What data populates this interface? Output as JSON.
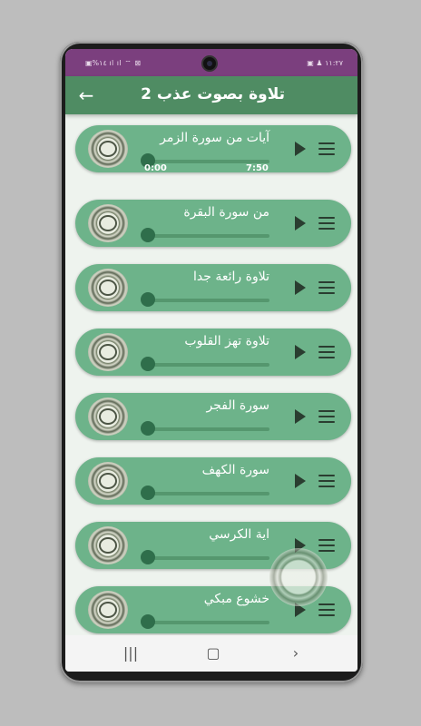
{
  "status": {
    "left": "▣%١٤ ıl ıl ⌔ ⊠",
    "right": "▣ ♟ ١١:٢٧"
  },
  "header": {
    "title": "تلاوة بصوت عذب 2",
    "back_icon": "arrow-left-icon"
  },
  "tracks": [
    {
      "title": "آيات من سورة الزمر",
      "start": "0:00",
      "end": "7:50"
    },
    {
      "title": "من سورة البقرة"
    },
    {
      "title": "تلاوة رائعة جدا"
    },
    {
      "title": "تلاوة تهز القلوب"
    },
    {
      "title": "سورة الفجر"
    },
    {
      "title": "سورة الكهف"
    },
    {
      "title": "اية الكرسي"
    },
    {
      "title": "خشوع مبكي"
    }
  ],
  "nav": {
    "recents": "|||",
    "home": "▢",
    "back": "›"
  },
  "colors": {
    "statusbar": "#7b3f7e",
    "appbar": "#4f8c63",
    "item": "#6db38a",
    "knob": "#2f6e4b"
  }
}
